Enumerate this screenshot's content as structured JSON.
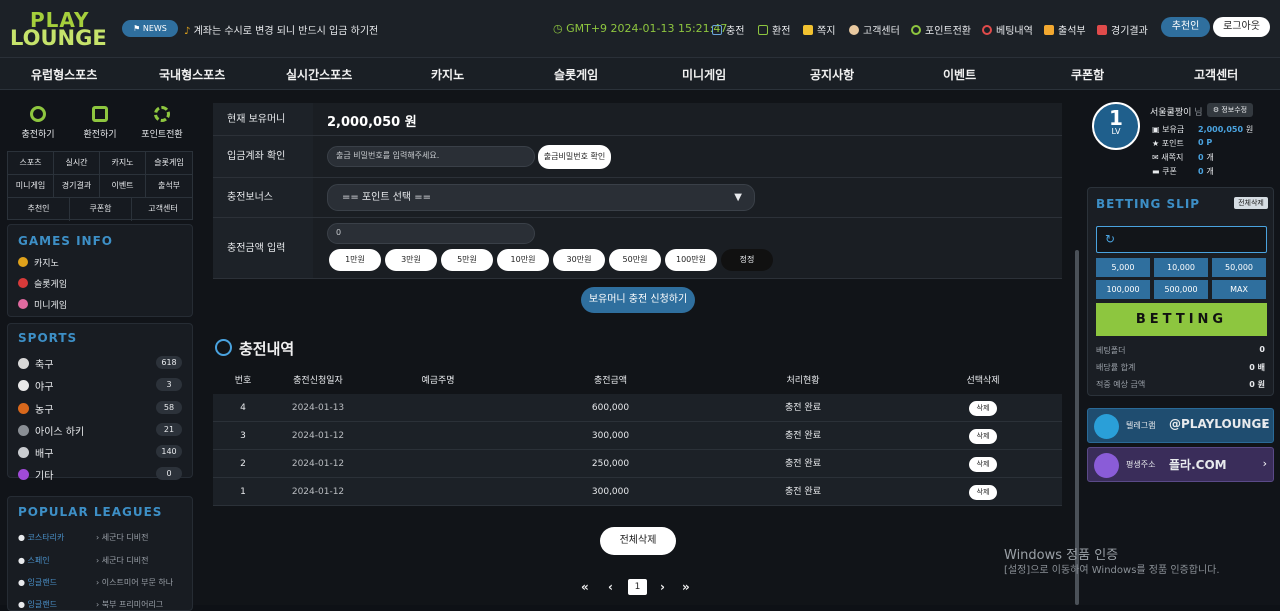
{
  "header": {
    "logo_top": "PLAY",
    "logo_bottom": "LOUNGE",
    "news_badge": "⚑ NEWS",
    "news_text": "계좌는 수시로 변경 되니 반드시 입금 하기전",
    "time": "GMT+9 2024-01-13 15:21:47",
    "links": [
      {
        "label": "충전",
        "icon": "card-icon",
        "color": "#6aa5d8"
      },
      {
        "label": "환전",
        "icon": "check-icon",
        "color": "#8ec63f"
      },
      {
        "label": "쪽지",
        "icon": "note-icon",
        "color": "#f2c230"
      },
      {
        "label": "고객센터",
        "icon": "hand-icon",
        "color": "#e8c9a0"
      },
      {
        "label": "포인트전환",
        "icon": "refresh-icon",
        "color": "#8ec63f"
      },
      {
        "label": "베팅내역",
        "icon": "target-icon",
        "color": "#e04b4b"
      },
      {
        "label": "출석부",
        "icon": "puzzle-icon",
        "color": "#f2a830"
      },
      {
        "label": "경기결과",
        "icon": "flag-icon",
        "color": "#e04b4b"
      }
    ],
    "recommend_button": "추천인",
    "logout_button": "로그아웃"
  },
  "nav": [
    "유럽형스포츠",
    "국내형스포츠",
    "실시간스포츠",
    "카지노",
    "슬롯게임",
    "미니게임",
    "공지사항",
    "이벤트",
    "쿠폰함",
    "고객센터"
  ],
  "left": {
    "quick": [
      {
        "label": "충전하기",
        "icon": "charge-icon"
      },
      {
        "label": "환전하기",
        "icon": "exchange-icon"
      },
      {
        "label": "포인트전환",
        "icon": "point-convert-icon"
      }
    ],
    "grid": [
      [
        "스포츠",
        "실시간",
        "카지노",
        "슬롯게임"
      ],
      [
        "미니게임",
        "경기결과",
        "이벤트",
        "출석부"
      ],
      [
        "추천인",
        "쿠폰함",
        "고객센터"
      ]
    ],
    "games_title": "GAMES INFO",
    "games": [
      {
        "label": "카지노",
        "color": "#e0a21b"
      },
      {
        "label": "슬롯게임",
        "color": "#d83a3a"
      },
      {
        "label": "미니게임",
        "color": "#e06aa0"
      }
    ],
    "sports_title": "SPORTS",
    "sports": [
      {
        "label": "축구",
        "count": "618",
        "color": "#d8d8d8"
      },
      {
        "label": "야구",
        "count": "3",
        "color": "#e8e8e8"
      },
      {
        "label": "농구",
        "count": "58",
        "color": "#d8681c"
      },
      {
        "label": "아이스 하키",
        "count": "21",
        "color": "#8a8f95"
      },
      {
        "label": "배구",
        "count": "140",
        "color": "#c9ccd0"
      },
      {
        "label": "기타",
        "count": "0",
        "color": "#a04ad8"
      }
    ],
    "leagues_title": "POPULAR LEAGUES",
    "leagues": [
      {
        "country": "코스타리카",
        "league": "세군다 디비전"
      },
      {
        "country": "스페인",
        "league": "세군다 디비전"
      },
      {
        "country": "잉글랜드",
        "league": "이스트미어 부문 하나"
      },
      {
        "country": "잉글랜드",
        "league": "북부 프리미어리그"
      }
    ]
  },
  "form": {
    "balance_label": "현재 보유머니",
    "balance_value": "2,000,050 원",
    "account_label": "입금계좌 확인",
    "account_placeholder": "출금 비밀번호를 입력해주세요.",
    "account_button": "출금비밀번호 확인",
    "bonus_label": "충전보너스",
    "bonus_select": "== 포인트 선택 ==",
    "amount_label": "충전금액 입력",
    "amount_value": "0",
    "amount_buttons": [
      "1만원",
      "3만원",
      "5만원",
      "10만원",
      "30만원",
      "50만원",
      "100만원"
    ],
    "reset_button": "정정",
    "submit_button": "보유머니 충전 신청하기"
  },
  "history": {
    "title": "충전내역",
    "columns": [
      "번호",
      "충전신청일자",
      "예금주명",
      "충전금액",
      "처리현황",
      "선택삭제"
    ],
    "rows": [
      {
        "no": "4",
        "date": "2024-01-13",
        "name": "",
        "amount": "600,000",
        "status": "충전 완료",
        "action": "삭제"
      },
      {
        "no": "3",
        "date": "2024-01-12",
        "name": "",
        "amount": "300,000",
        "status": "충전 완료",
        "action": "삭제"
      },
      {
        "no": "2",
        "date": "2024-01-12",
        "name": "",
        "amount": "250,000",
        "status": "충전 완료",
        "action": "삭제"
      },
      {
        "no": "1",
        "date": "2024-01-12",
        "name": "",
        "amount": "300,000",
        "status": "충전 완료",
        "action": "삭제"
      }
    ],
    "delete_all": "전체삭제",
    "pagination": {
      "first": "«",
      "prev": "‹",
      "current": "1",
      "next": "›",
      "last": "»"
    }
  },
  "user": {
    "level": "1",
    "level_label": "LV",
    "name": "서울쿨짱이",
    "suffix": "님",
    "edit_button": "⚙ 정보수정",
    "stats": [
      {
        "label": "보유금",
        "value": "2,000,050",
        "unit": "원"
      },
      {
        "label": "포인트",
        "value": "0",
        "unit": "P"
      },
      {
        "label": "새쪽지",
        "value": "0",
        "unit": "개"
      },
      {
        "label": "쿠폰",
        "value": "0",
        "unit": "개"
      }
    ]
  },
  "slip": {
    "title": "BETTING SLIP",
    "clear": "전체삭제",
    "chips": [
      "5,000",
      "10,000",
      "50,000",
      "100,000",
      "500,000",
      "MAX"
    ],
    "bet_button": "BETTING",
    "lines": [
      {
        "label": "베팅폴더",
        "value": "0"
      },
      {
        "label": "배당률 합계",
        "value": "0 배"
      },
      {
        "label": "적중 예상 금액",
        "value": "0 원"
      }
    ]
  },
  "promos": [
    {
      "label": "텔레그램",
      "value": "@PLAYLOUNGE",
      "color": "#2a9fd8"
    },
    {
      "label": "평생주소",
      "value": "플라.COM",
      "color": "#8a5cd8"
    }
  ],
  "watermark": {
    "line1": "Windows 정품 인증",
    "line2": "[설정]으로 이동하여 Windows를 정품 인증합니다."
  }
}
